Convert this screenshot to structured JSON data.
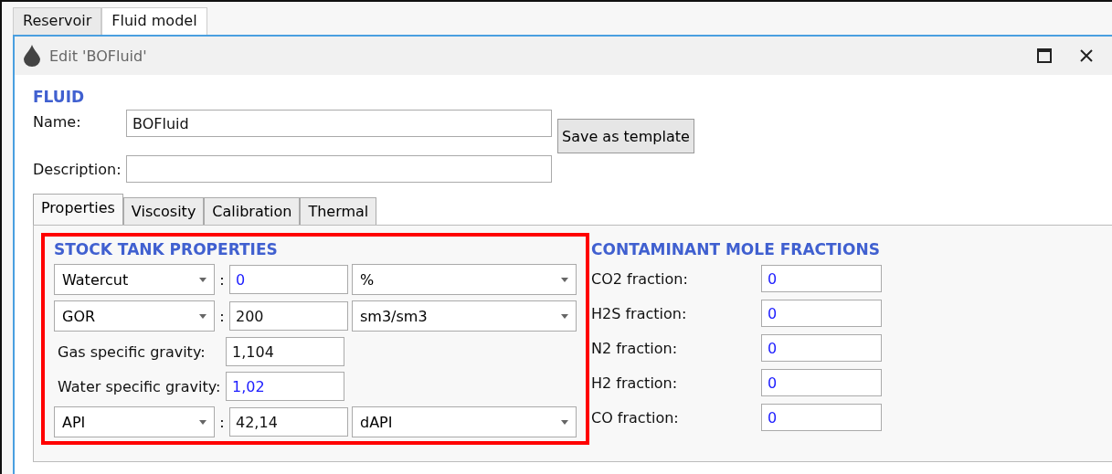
{
  "outer_tabs": [
    {
      "label": "Reservoir",
      "selected": false
    },
    {
      "label": "Fluid model",
      "selected": true
    }
  ],
  "window": {
    "title": "Edit 'BOFluid'"
  },
  "fluid": {
    "heading": "FLUID",
    "name_label": "Name:",
    "name_value": "BOFluid",
    "save_button": "Save as template",
    "description_label": "Description:"
  },
  "tabs": [
    {
      "label": "Properties",
      "selected": true
    },
    {
      "label": "Viscosity",
      "selected": false
    },
    {
      "label": "Calibration",
      "selected": false
    },
    {
      "label": "Thermal",
      "selected": false
    }
  ],
  "stock_tank": {
    "heading": "STOCK TANK PROPERTIES",
    "highlighted": true,
    "rows": [
      {
        "kind": "select",
        "property": "Watercut",
        "separator": ":",
        "value": "0",
        "default": true,
        "unit": "%"
      },
      {
        "kind": "select",
        "property": "GOR",
        "separator": ":",
        "value": "200",
        "default": false,
        "unit": "sm3/sm3"
      },
      {
        "kind": "label",
        "property": "Gas specific gravity:",
        "value": "1,104",
        "default": false
      },
      {
        "kind": "label",
        "property": "Water specific gravity:",
        "value": "1,02",
        "default": true
      },
      {
        "kind": "select",
        "property": "API",
        "separator": ":",
        "value": "42,14",
        "default": false,
        "unit": "dAPI"
      }
    ]
  },
  "contaminants": {
    "heading": "CONTAMINANT MOLE FRACTIONS",
    "rows": [
      {
        "label": "CO2 fraction:",
        "value": "0",
        "default": true
      },
      {
        "label": "H2S fraction:",
        "value": "0",
        "default": true
      },
      {
        "label": "N2 fraction:",
        "value": "0",
        "default": true
      },
      {
        "label": "H2 fraction:",
        "value": "0",
        "default": true
      },
      {
        "label": "CO fraction:",
        "value": "0",
        "default": true
      }
    ]
  }
}
